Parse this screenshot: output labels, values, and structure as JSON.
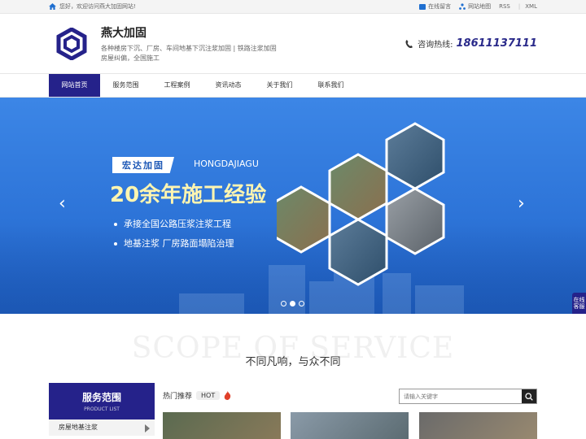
{
  "topbar": {
    "welcome": "您好，欢迎访问燕大加固网站!",
    "links": [
      "在线留言",
      "网站地图",
      "RSS",
      "XML"
    ]
  },
  "header": {
    "company": "燕大加固",
    "desc": "各种楼房下沉、厂房、车间地基下沉注浆加固 | 铁路注浆加固房屋纠偏，全国施工",
    "hotline_label": "咨询热线:",
    "hotline_number": "18611137111"
  },
  "nav": [
    "网站首页",
    "服务范围",
    "工程案例",
    "资讯动态",
    "关于我们",
    "联系我们"
  ],
  "banner": {
    "tag_cn": "宏达加固",
    "tag_en": "HONGDAJIAGU",
    "headline": "20余年施工经验",
    "bullets": [
      "承接全国公路压浆注浆工程",
      "地基注浆 厂房路面塌陷治理"
    ],
    "active_slide": 2,
    "slide_count": 3
  },
  "side_tab": "在线客服",
  "section": {
    "ghost": "SCOPE OF SERVICE",
    "subtitle": "不同凡响，与众不同"
  },
  "product_panel": {
    "title": "服务范围",
    "subtitle": "PRODUCT LIST",
    "items": [
      "房屋地基注浆"
    ]
  },
  "hot": {
    "label": "热门推荐",
    "badge": "HOT"
  },
  "search": {
    "placeholder": "请输入关键字"
  },
  "colors": {
    "brand": "#25228a",
    "banner": "#2d74d8"
  }
}
